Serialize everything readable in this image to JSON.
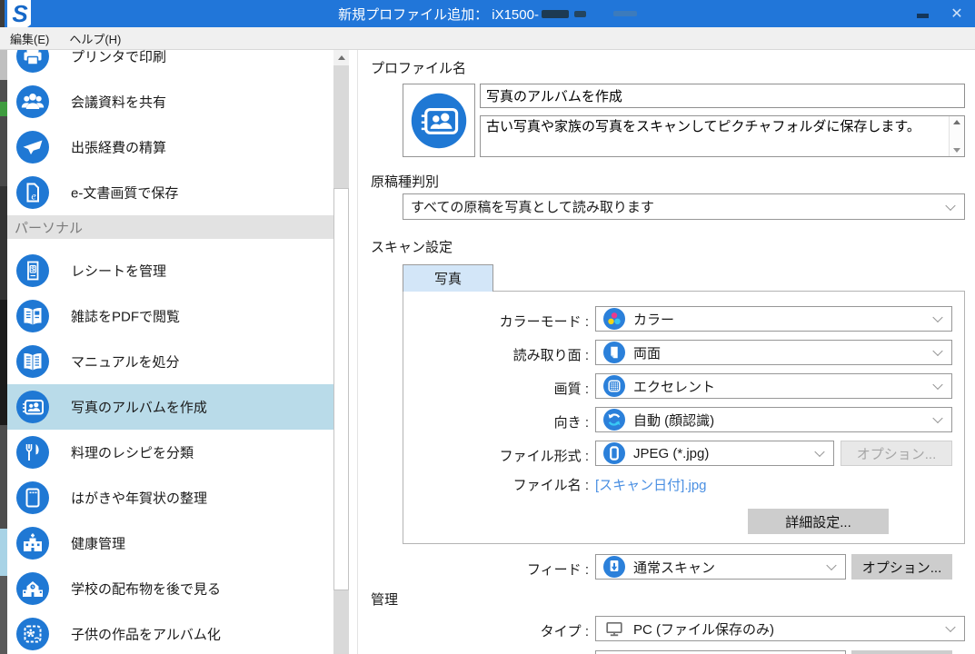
{
  "titlebar": {
    "title": "新規プロファイル追加：  iX1500-"
  },
  "menubar": {
    "edit": "編集(E)",
    "help": "ヘルプ(H)"
  },
  "sidebar": {
    "items_top": [
      {
        "label": "プリンタで印刷"
      },
      {
        "label": "会議資料を共有"
      },
      {
        "label": "出張経費の精算"
      },
      {
        "label": "e-文書画質で保存"
      }
    ],
    "section_personal": "パーソナル",
    "items_personal": [
      {
        "label": "レシートを管理"
      },
      {
        "label": "雑誌をPDFで閲覧"
      },
      {
        "label": "マニュアルを処分"
      },
      {
        "label": "写真のアルバムを作成"
      },
      {
        "label": "料理のレシピを分類"
      },
      {
        "label": "はがきや年賀状の整理"
      },
      {
        "label": "健康管理"
      },
      {
        "label": "学校の配布物を後で見る"
      },
      {
        "label": "子供の作品をアルバム化"
      }
    ],
    "selected_item": "写真のアルバムを作成"
  },
  "main": {
    "profile_name_label": "プロファイル名",
    "profile_name_value": "写真のアルバムを作成",
    "profile_description": "古い写真や家族の写真をスキャンしてピクチャフォルダに保存します。",
    "doc_type_label": "原稿種判別",
    "doc_type_value": "すべての原稿を写真として読み取ります",
    "scan_settings_label": "スキャン設定",
    "tab_label": "写真",
    "color_mode_label": "カラーモード :",
    "color_mode_value": "カラー",
    "scan_side_label": "読み取り面 :",
    "scan_side_value": "両面",
    "quality_label": "画質 :",
    "quality_value": "エクセレント",
    "orientation_label": "向き :",
    "orientation_value": "自動 (顔認識)",
    "file_format_label": "ファイル形式 :",
    "file_format_value": "JPEG (*.jpg)",
    "file_format_option_button": "オプション...",
    "file_name_label": "ファイル名 :",
    "file_name_value": "[スキャン日付].jpg",
    "detail_button": "詳細設定...",
    "feed_label": "フィード :",
    "feed_value": "通常スキャン",
    "feed_option_button": "オプション...",
    "manage_label": "管理",
    "type_label": "タイプ :",
    "type_value": "PC (ファイル保存のみ)"
  },
  "colors": {
    "titlebar_blue": "#2176d9",
    "icon_blue": "#1f78d4",
    "selected_row_bg": "#b9dbe9",
    "tab_active_bg": "#d3e6f8",
    "link_blue": "#4a8fe2"
  }
}
